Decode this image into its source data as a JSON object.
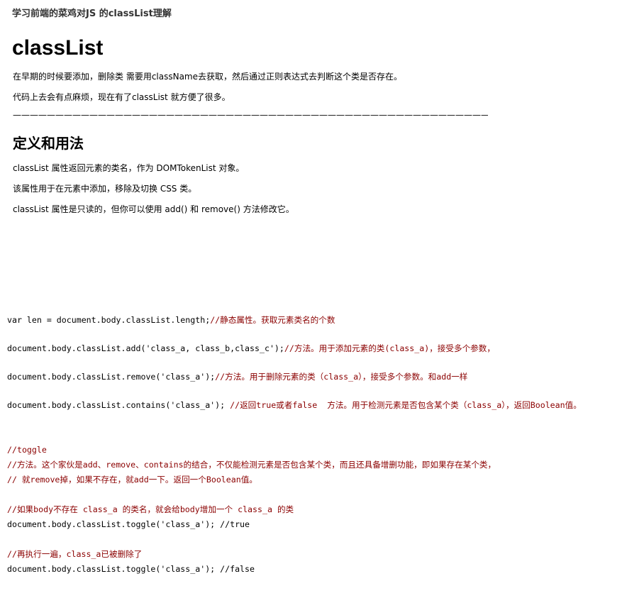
{
  "header": {
    "post_title": "学习前端的菜鸡对JS 的classList理解"
  },
  "article": {
    "heading": "classList",
    "intro": [
      "在早期的时候要添加，删除类 需要用className去获取，然后通过正则表达式去判断这个类是否存在。",
      "代码上去会有点麻烦，现在有了classList 就方便了很多。"
    ],
    "divider": "——————————————————————————————————————————————————————————.",
    "section_heading": "定义和用法",
    "definition": [
      "classList 属性返回元素的类名，作为 DOMTokenList 对象。",
      "该属性用于在元素中添加，移除及切换 CSS 类。",
      "classList 属性是只读的，但你可以使用 add() 和 remove() 方法修改它。"
    ]
  },
  "code": {
    "length_code": "var len = document.body.classList.length;",
    "length_comment": "//静态属性。获取元素类名的个数",
    "add_code": "document.body.classList.add('class_a, class_b,class_c');",
    "add_comment": "//方法。用于添加元素的类(class_a)，接受多个参数，",
    "remove_code": "document.body.classList.remove('class_a');",
    "remove_comment": "//方法。用于删除元素的类（class_a），接受多个参数。和add一样",
    "contains_code": "document.body.classList.contains('class_a'); ",
    "contains_comment": "//返回true或者false  方法。用于检测元素是否包含某个类（class_a），返回Boolean值。",
    "toggle_comment_1": "//toggle",
    "toggle_comment_2": "//方法。这个家伙是add、remove、contains的结合，不仅能检测元素是否包含某个类，而且还具备增删功能，即如果存在某个类，",
    "toggle_comment_3": "// 就remove掉，如果不存在，就add一下。返回一个Boolean值。",
    "toggle_comment_4": "//如果body不存在 class_a 的类名，就会给body增加一个 class_a 的类",
    "toggle_line_1": "document.body.classList.toggle('class_a'); //true",
    "toggle_comment_5": "//再执行一遍，class_a已被删除了",
    "toggle_line_2": "document.body.classList.toggle('class_a'); //false"
  },
  "colors": {
    "comment": "#8b0000",
    "text": "#000000",
    "title": "#333333"
  }
}
